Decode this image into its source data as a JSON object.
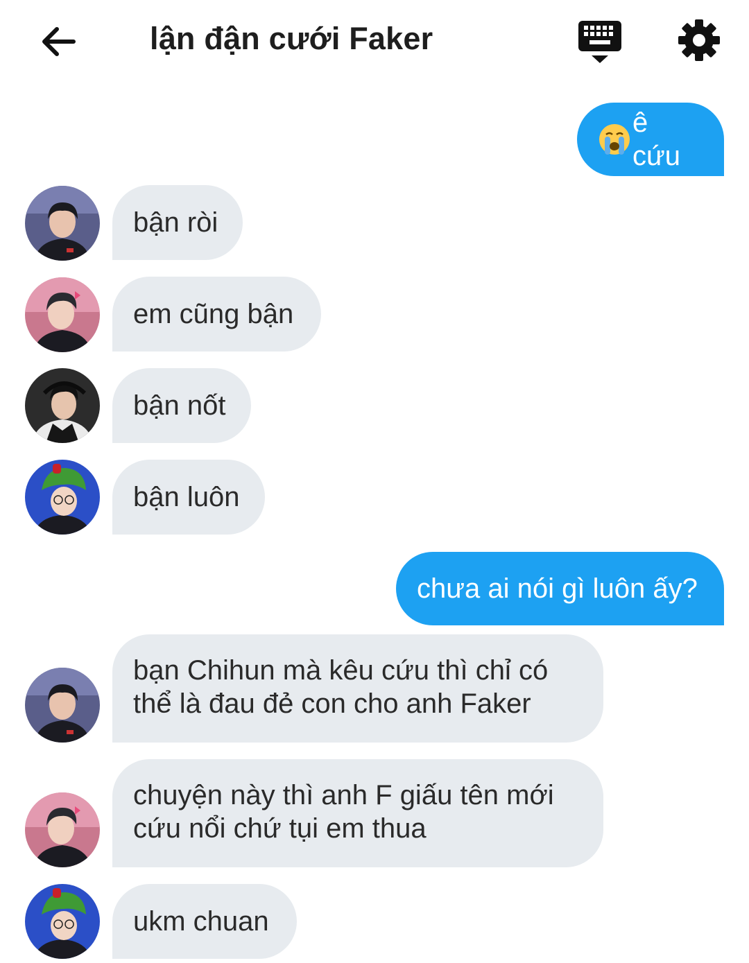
{
  "header": {
    "title": "lận đận cưới Faker",
    "back_icon": "arrow-left-icon",
    "keyboard_icon": "keyboard-icon",
    "settings_icon": "gear-icon"
  },
  "messages": [
    {
      "direction": "out",
      "emoji": "loudly-crying-face",
      "text": "ê cứu"
    },
    {
      "direction": "in",
      "avatar": "avatar-player-1",
      "text": "bận ròi"
    },
    {
      "direction": "in",
      "avatar": "avatar-player-2",
      "text": "em cũng bận"
    },
    {
      "direction": "in",
      "avatar": "avatar-player-3",
      "text": "bận nốt"
    },
    {
      "direction": "in",
      "avatar": "avatar-player-4",
      "text": "bận luôn"
    },
    {
      "direction": "out",
      "text": "chưa ai nói gì luôn ấy?"
    },
    {
      "direction": "in",
      "avatar": "avatar-player-1",
      "lines": [
        "bạn Chihun mà kêu cứu thì chỉ có",
        "thể là đau đẻ con cho anh Faker"
      ]
    },
    {
      "direction": "in",
      "avatar": "avatar-player-2",
      "lines": [
        "chuyện này thì anh F giấu tên mới",
        "cứu nổi chứ tụi em thua"
      ]
    },
    {
      "direction": "in",
      "avatar": "avatar-player-4",
      "text": "ukm chuan"
    }
  ],
  "colors": {
    "outgoing_bubble": "#1da1f2",
    "incoming_bubble": "#e7ebef",
    "title_text": "#1e1e1e"
  }
}
